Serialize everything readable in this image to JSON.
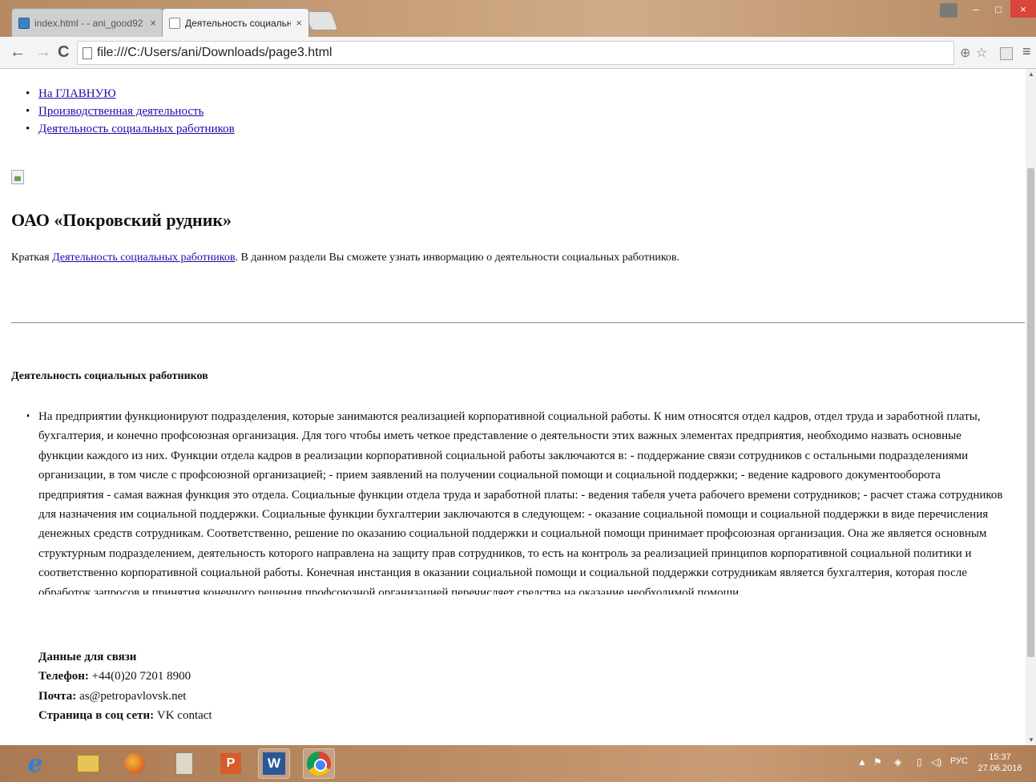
{
  "browser": {
    "tabs": [
      {
        "title": "index.html - - ani_good92",
        "close": "×"
      },
      {
        "title": "Деятельность социальны",
        "close": "×"
      }
    ],
    "address": "file:///C:/Users/ani/Downloads/page3.html",
    "nav_icons": {
      "back": "←",
      "forward": "→",
      "reload": "C",
      "zoom": "⊕",
      "star": "☆",
      "menu": "≡"
    },
    "window_controls": {
      "minimize": "–",
      "maximize": "□",
      "close": "×"
    }
  },
  "page": {
    "nav": [
      {
        "label": "На ГЛАВНУЮ"
      },
      {
        "label": "Производственная деятельность"
      },
      {
        "label": "Деятельность социальных работников"
      }
    ],
    "title": "ОАО «Покровский рудник»",
    "intro": {
      "prefix": "Краткая",
      "link": "Деятельность социальных работников",
      "suffix": ". В данном раздели Вы сможете узнать инвормацию о деятельности социальных работников."
    },
    "section_title": "Деятельность социальных работников",
    "body": "На предприятии функционируют подразделения, которые занимаются реализацией корпоративной социальной работы. К ним относятся отдел кадров, отдел труда и заработной платы, бухгалтерия, и конечно профсоюзная организация. Для того чтобы иметь четкое представление о деятельности этих важных элементах предприятия, необходимо назвать основные функции каждого из них. Функции отдела кадров в реализации корпоративной социальной работы заключаются в: - поддержание связи сотрудников с остальными подразделениями организации, в том числе с профсоюзной организацией; - прием заявлений на получении социальной помощи и социальной поддержки; - ведение кадрового документооборота предприятия - самая важная функция это отдела. Социальные функции отдела труда и заработной платы: - ведения табеля учета рабочего времени сотрудников; - расчет стажа сотрудников для назначения им социальной поддержки. Социальные функции бухгалтерии заключаются в следующем: - оказание социальной помощи и социальной поддержки в виде перечисления денежных средств сотрудникам. Соответственно, решение по оказанию социальной поддержки и социальной помощи принимает профсоюзная организация. Она же является основным структурным подразделением, деятельность которого направлена на защиту прав сотрудников, то есть на контроль за реализацией принципов корпоративной социальной политики и соответственно корпоративной социальной работы. Конечная инстанция в оказании социальной помощи и социальной поддержки сотрудникам является бухгалтерия, которая после обработок запросов и принятия конечного решения профсоюзной организацией перечисляет средства на оказание необходимой помощи.",
    "contacts": {
      "heading": "Данные для связи",
      "phone_label": "Телефон:",
      "phone": "+44(0)20 7201 8900",
      "mail_label": "Почта:",
      "mail": "as@petropavlovsk.net",
      "social_label": "Страница в соц сети:",
      "social": "VK contact"
    }
  },
  "taskbar": {
    "apps": [
      "internet-explorer-icon",
      "file-explorer-icon",
      "mozilla-icon",
      "document-icon",
      "powerpoint-icon",
      "word-icon",
      "chrome-icon"
    ],
    "lang": "РУС",
    "time": "15:37",
    "date": "27.06.2016"
  }
}
